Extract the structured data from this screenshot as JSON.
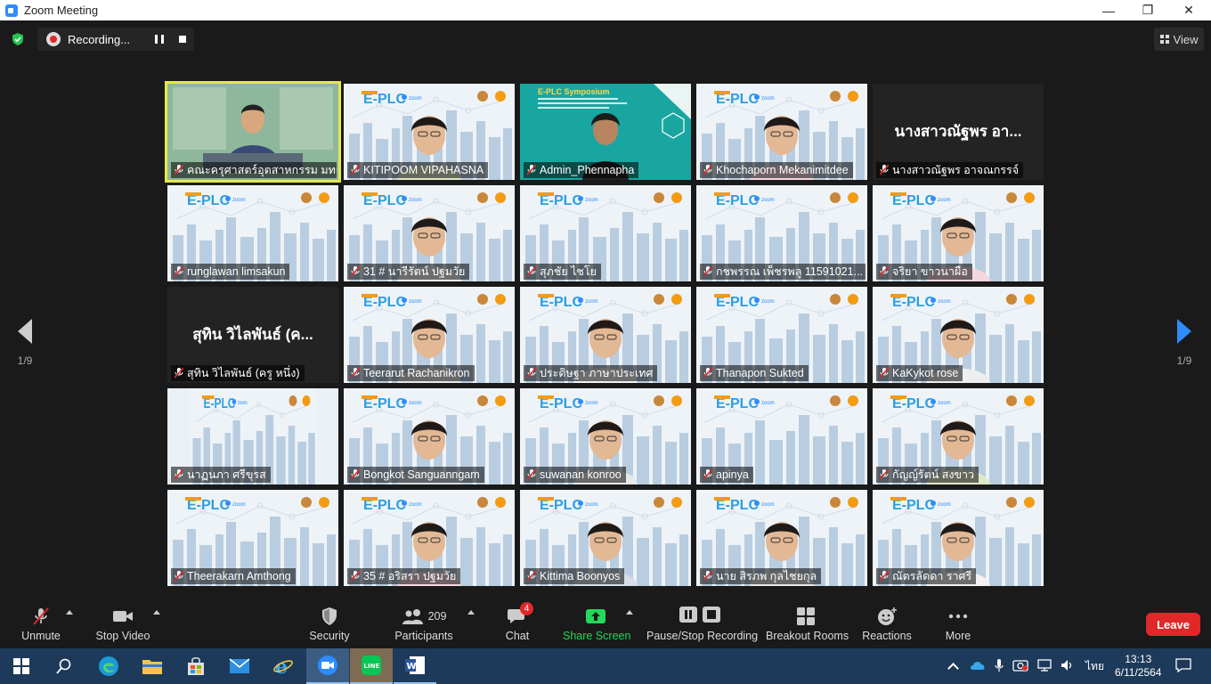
{
  "window": {
    "title": "Zoom Meeting"
  },
  "top": {
    "recording_label": "Recording...",
    "view_label": "View"
  },
  "pager": {
    "left": "1/9",
    "right": "1/9"
  },
  "tiles": [
    {
      "name": "คณะครุศาสตร์อุตสาหกรรม มทร....",
      "type": "host"
    },
    {
      "name": "KITIPOOM VIPAHASNA",
      "type": "person"
    },
    {
      "name": "Admin_Phennapha",
      "type": "symposium"
    },
    {
      "name": "Khochaporn Mekanimitdee",
      "type": "person"
    },
    {
      "name": "นางสาวณัฐพร อาจณกรรจ์",
      "type": "dark",
      "big": "นางสาวณัฐพร อา..."
    },
    {
      "name": "runglawan limsakun",
      "type": "bg"
    },
    {
      "name": "31 # นารีรัตน์ ปฐมวัย",
      "type": "person"
    },
    {
      "name": "สุภชัย ไชโย",
      "type": "bg"
    },
    {
      "name": "กชพรรณ เพ็ชรพลู 11591021...",
      "type": "bg"
    },
    {
      "name": "จริยา ขาวนาผือ",
      "type": "person"
    },
    {
      "name": "สุทิน วิไลพันธ์ (ครู หนึ่ง)",
      "type": "dark",
      "big": "สุทิน วิไลพันธ์ (ค..."
    },
    {
      "name": "Teerarut Rachanikron",
      "type": "person"
    },
    {
      "name": "ประดิษฐา ภาษาประเทศ",
      "type": "person"
    },
    {
      "name": "Thanapon Sukted",
      "type": "bg"
    },
    {
      "name": "KaKykot rose",
      "type": "person"
    },
    {
      "name": "นาฏนภา ศรีขุรส",
      "type": "bgsmall"
    },
    {
      "name": "Bongkot Sanguanngam",
      "type": "person"
    },
    {
      "name": "suwanan konroo",
      "type": "person"
    },
    {
      "name": "apinya",
      "type": "bg"
    },
    {
      "name": "กัญญ์รัตน์ สงขาว",
      "type": "person"
    },
    {
      "name": "Theerakarn Amthong",
      "type": "bg"
    },
    {
      "name": "35 # อริสรา ปฐมวัย",
      "type": "person"
    },
    {
      "name": "Kittima Boonyos",
      "type": "person"
    },
    {
      "name": "นาย สิรภพ กุลไชยกุล",
      "type": "person"
    },
    {
      "name": "ณัตรลัดดา ราศรี",
      "type": "person"
    }
  ],
  "toolbar": {
    "unmute": "Unmute",
    "stop_video": "Stop Video",
    "security": "Security",
    "participants": "Participants",
    "participants_count": "209",
    "chat": "Chat",
    "chat_badge": "4",
    "share_screen": "Share Screen",
    "recording": "Pause/Stop Recording",
    "breakout": "Breakout Rooms",
    "reactions": "Reactions",
    "more": "More",
    "leave": "Leave"
  },
  "taskbar": {
    "lang": "ไทย",
    "time": "13:13",
    "date": "6/11/2564",
    "apps": [
      "start-icon",
      "search-icon",
      "edge-icon",
      "file-explorer-icon",
      "store-icon",
      "mail-icon",
      "ie-icon",
      "zoom-icon",
      "line-icon",
      "word-icon"
    ]
  },
  "colors": {
    "accent_blue": "#2d8cff",
    "leave_red": "#e02828",
    "share_green": "#23d959",
    "active_border": "#e6e84a"
  }
}
